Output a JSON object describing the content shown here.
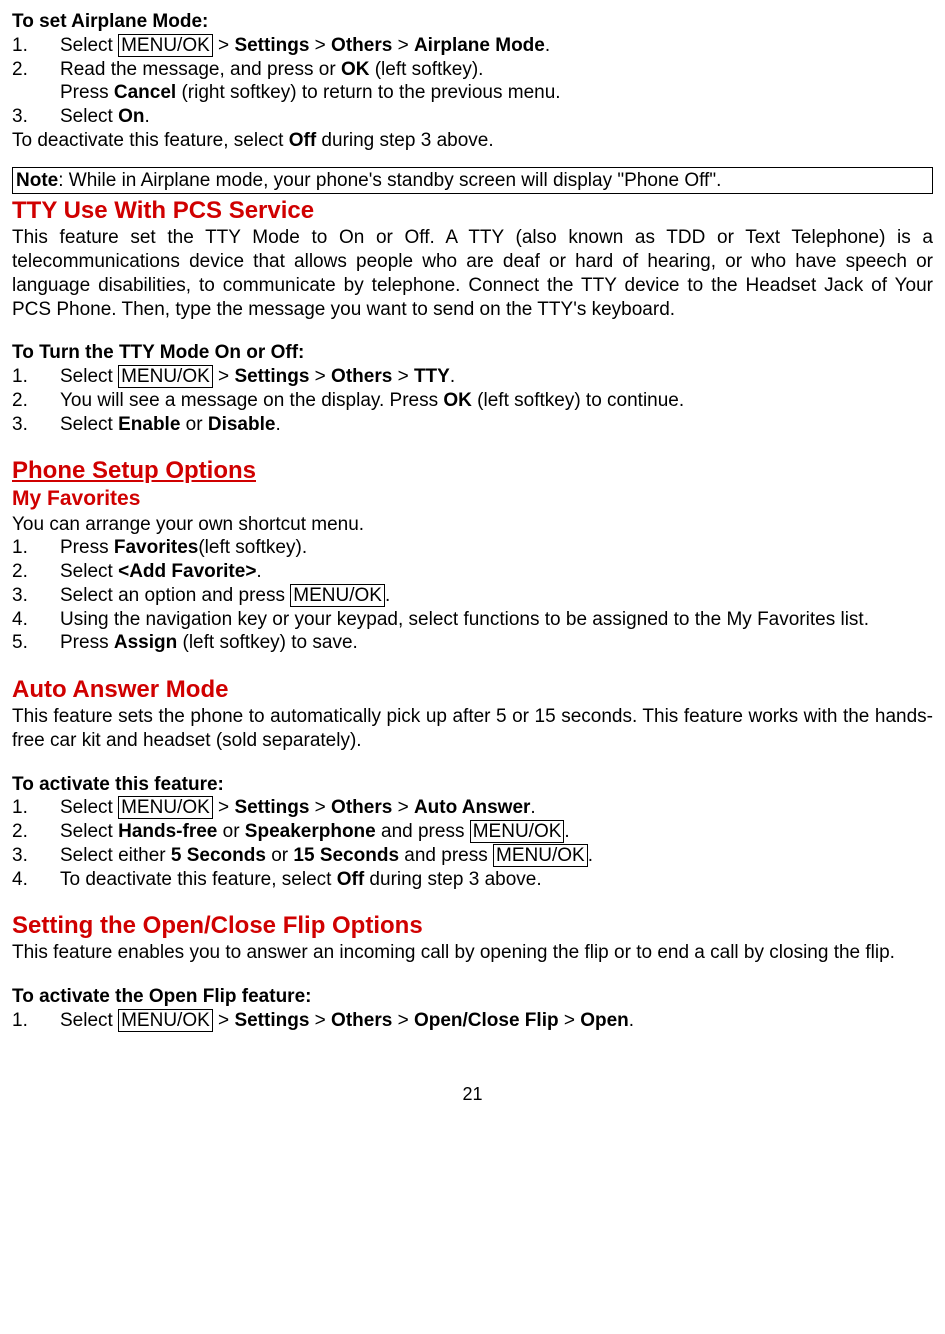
{
  "airplane": {
    "heading": "To set Airplane Mode:",
    "step1_a": "Select ",
    "step1_menu": "MENU/OK",
    "step1_b": " > ",
    "step1_settings": "Settings",
    "step1_c": " > ",
    "step1_others": "Others",
    "step1_d": " > ",
    "step1_airplane": "Airplane Mode",
    "step1_e": ".",
    "step2_a": "Read the message, and press or ",
    "step2_ok": "OK",
    "step2_b": " (left softkey).",
    "step2_sub_a": "Press ",
    "step2_sub_cancel": "Cancel",
    "step2_sub_b": " (right softkey) to return to the previous menu.",
    "step3_a": "Select ",
    "step3_on": "On",
    "step3_b": ".",
    "deactivate_a": "To deactivate this feature, select ",
    "deactivate_off": "Off",
    "deactivate_b": " during step 3 above."
  },
  "note": {
    "label": "Note",
    "text": ": While in Airplane mode, your phone's standby screen will display \"Phone Off\"."
  },
  "tty": {
    "heading": "TTY Use With PCS Service",
    "para": "This feature set the TTY Mode to On or Off. A TTY (also known as TDD or Text Telephone) is a telecommunications device that allows people who are deaf or hard of hearing, or who have speech or language disabilities, to communicate by telephone. Connect the TTY device to the Headset Jack of Your PCS Phone. Then, type the message you want to send on the TTY's keyboard.",
    "sub_heading": "To Turn the TTY Mode On or Off:",
    "step1_a": "Select ",
    "step1_menu": "MENU/OK",
    "step1_b": " > ",
    "step1_settings": "Settings",
    "step1_c": " > ",
    "step1_others": "Others",
    "step1_d": " > ",
    "step1_tty": "TTY",
    "step1_e": ".",
    "step2_a": "You will see a message on the display. Press ",
    "step2_ok": "OK",
    "step2_b": " (left softkey) to continue.",
    "step3_a": "Select ",
    "step3_enable": "Enable",
    "step3_b": " or ",
    "step3_disable": "Disable",
    "step3_c": "."
  },
  "setup": {
    "heading": "Phone Setup Options"
  },
  "fav": {
    "heading": "My Favorites",
    "para": "You can arrange your own shortcut menu.",
    "step1_a": "Press ",
    "step1_fav": "Favorites",
    "step1_b": "(left softkey).",
    "step2_a": "Select ",
    "step2_add": "<Add Favorite>",
    "step2_b": ".",
    "step3_a": "Select an option and press ",
    "step3_menu": "MENU/OK",
    "step3_b": ".",
    "step4": "Using the navigation key or your keypad, select functions to be assigned to the My Favorites list.",
    "step5_a": "Press ",
    "step5_assign": "Assign",
    "step5_b": " (left softkey) to save."
  },
  "auto": {
    "heading": "Auto Answer Mode",
    "para": "This feature sets the phone to automatically pick up after 5 or 15 seconds. This feature works with the hands-free car kit and headset (sold separately).",
    "sub_heading": "To activate this feature:",
    "step1_a": "Select ",
    "step1_menu": "MENU/OK",
    "step1_b": " > ",
    "step1_settings": "Settings",
    "step1_c": " > ",
    "step1_others": "Others",
    "step1_d": " > ",
    "step1_auto": "Auto Answer",
    "step1_e": ".",
    "step2_a": "Select ",
    "step2_hf": "Hands-free",
    "step2_b": " or ",
    "step2_sp": "Speakerphone",
    "step2_c": " and press ",
    "step2_menu": "MENU/OK",
    "step2_d": ".",
    "step3_a": "Select either ",
    "step3_5": "5 Seconds",
    "step3_b": " or ",
    "step3_15": "15 Seconds",
    "step3_c": " and press ",
    "step3_menu": "MENU/OK",
    "step3_d": ".",
    "step4_a": "To deactivate this feature, select ",
    "step4_off": "Off",
    "step4_b": " during step 3 above."
  },
  "flip": {
    "heading": "Setting the Open/Close Flip Options",
    "para": "This feature enables you to answer an incoming call by opening the flip or to end a call by closing the flip.",
    "sub_heading": "To activate the Open Flip feature:",
    "step1_a": "Select ",
    "step1_menu": "MENU/OK",
    "step1_b": " > ",
    "step1_settings": "Settings",
    "step1_c": " > ",
    "step1_others": "Others",
    "step1_d": " > ",
    "step1_ocf": "Open/Close Flip",
    "step1_e": " > ",
    "step1_open": "Open",
    "step1_f": "."
  },
  "page": "21"
}
